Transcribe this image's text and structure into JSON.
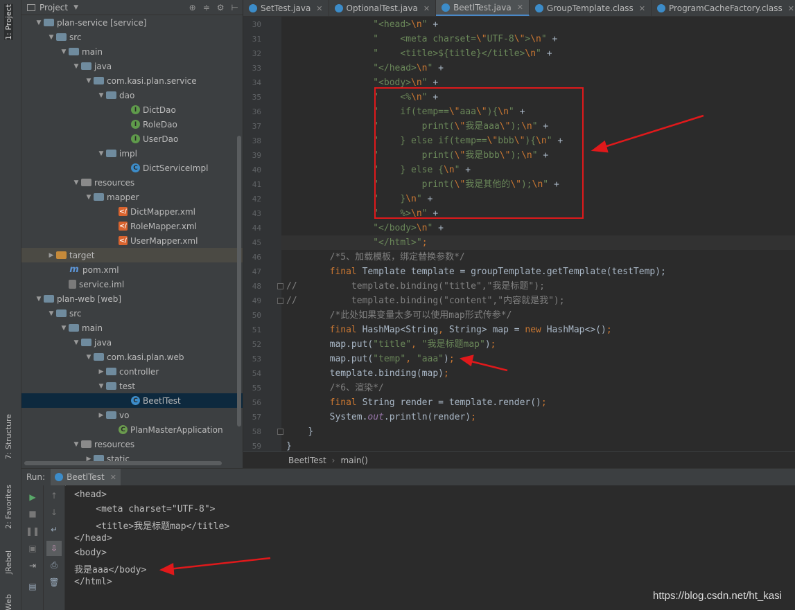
{
  "left_strip": {
    "project_tab": "1: Project",
    "structure_tab": "7: Structure",
    "favorites_tab": "2: Favorites",
    "jrebel_tab": "JRebel",
    "web_tab": "Web"
  },
  "project_panel": {
    "title": "Project",
    "tree": [
      {
        "label": "plan-service [service]",
        "indent": 0,
        "arrow": "▼",
        "icon": "folder",
        "hl": false
      },
      {
        "label": "src",
        "indent": 1,
        "arrow": "▼",
        "icon": "folder",
        "hl": false
      },
      {
        "label": "main",
        "indent": 2,
        "arrow": "▼",
        "icon": "folder",
        "hl": false
      },
      {
        "label": "java",
        "indent": 3,
        "arrow": "▼",
        "icon": "folder",
        "hl": false
      },
      {
        "label": "com.kasi.plan.service",
        "indent": 4,
        "arrow": "▼",
        "icon": "folder",
        "hl": false
      },
      {
        "label": "dao",
        "indent": 5,
        "arrow": "▼",
        "icon": "folder",
        "hl": false
      },
      {
        "label": "DictDao",
        "indent": 7,
        "arrow": "",
        "icon": "iface",
        "hl": false
      },
      {
        "label": "RoleDao",
        "indent": 7,
        "arrow": "",
        "icon": "iface",
        "hl": false
      },
      {
        "label": "UserDao",
        "indent": 7,
        "arrow": "",
        "icon": "iface",
        "hl": false
      },
      {
        "label": "impl",
        "indent": 5,
        "arrow": "▼",
        "icon": "folder",
        "hl": false
      },
      {
        "label": "DictServiceImpl",
        "indent": 7,
        "arrow": "",
        "icon": "cls",
        "hl": false
      },
      {
        "label": "resources",
        "indent": 3,
        "arrow": "▼",
        "icon": "res",
        "hl": false
      },
      {
        "label": "mapper",
        "indent": 4,
        "arrow": "▼",
        "icon": "folder",
        "hl": false
      },
      {
        "label": "DictMapper.xml",
        "indent": 6,
        "arrow": "",
        "icon": "xml",
        "hl": false
      },
      {
        "label": "RoleMapper.xml",
        "indent": 6,
        "arrow": "",
        "icon": "xml",
        "hl": false
      },
      {
        "label": "UserMapper.xml",
        "indent": 6,
        "arrow": "",
        "icon": "xml",
        "hl": false
      },
      {
        "label": "target",
        "indent": 1,
        "arrow": "▶",
        "icon": "orange",
        "hl": true
      },
      {
        "label": "pom.xml",
        "indent": 2,
        "arrow": "",
        "icon": "mvn",
        "hl": false
      },
      {
        "label": "service.iml",
        "indent": 2,
        "arrow": "",
        "icon": "iml",
        "hl": false
      },
      {
        "label": "plan-web [web]",
        "indent": 0,
        "arrow": "▼",
        "icon": "folder",
        "hl": false
      },
      {
        "label": "src",
        "indent": 1,
        "arrow": "▼",
        "icon": "folder",
        "hl": false
      },
      {
        "label": "main",
        "indent": 2,
        "arrow": "▼",
        "icon": "folder",
        "hl": false
      },
      {
        "label": "java",
        "indent": 3,
        "arrow": "▼",
        "icon": "folder",
        "hl": false
      },
      {
        "label": "com.kasi.plan.web",
        "indent": 4,
        "arrow": "▼",
        "icon": "folder",
        "hl": false
      },
      {
        "label": "controller",
        "indent": 5,
        "arrow": "▶",
        "icon": "folder",
        "hl": false
      },
      {
        "label": "test",
        "indent": 5,
        "arrow": "▼",
        "icon": "folder",
        "hl": false
      },
      {
        "label": "BeetlTest",
        "indent": 7,
        "arrow": "",
        "icon": "cls",
        "hl": false,
        "sel": true
      },
      {
        "label": "vo",
        "indent": 5,
        "arrow": "▶",
        "icon": "folder",
        "hl": false
      },
      {
        "label": "PlanMasterApplication",
        "indent": 6,
        "arrow": "",
        "icon": "spring",
        "hl": false
      },
      {
        "label": "resources",
        "indent": 3,
        "arrow": "▼",
        "icon": "res",
        "hl": false
      },
      {
        "label": "static",
        "indent": 4,
        "arrow": "▶",
        "icon": "folder",
        "hl": false
      }
    ]
  },
  "editor_tabs": [
    {
      "label": "SetTest.java",
      "active": false
    },
    {
      "label": "OptionalTest.java",
      "active": false
    },
    {
      "label": "BeetlTest.java",
      "active": true
    },
    {
      "label": "GroupTemplate.class",
      "active": false
    },
    {
      "label": "ProgramCacheFactory.class",
      "active": false
    }
  ],
  "editor": {
    "lines": [
      {
        "n": "30",
        "html": "                <span class='s'>\"&lt;head&gt;</span><span class='e'>\\n</span><span class='s'>\"</span> <span class='t'>+</span>"
      },
      {
        "n": "31",
        "html": "                <span class='s'>\"    &lt;meta charset=</span><span class='e'>\\\"</span><span class='s'>UTF-8</span><span class='e'>\\\"</span><span class='s'>&gt;</span><span class='e'>\\n</span><span class='s'>\"</span> <span class='t'>+</span>"
      },
      {
        "n": "32",
        "html": "                <span class='s'>\"    &lt;title&gt;${title}&lt;/title&gt;</span><span class='e'>\\n</span><span class='s'>\"</span> <span class='t'>+</span>"
      },
      {
        "n": "33",
        "html": "                <span class='s'>\"&lt;/head&gt;</span><span class='e'>\\n</span><span class='s'>\"</span> <span class='t'>+</span>"
      },
      {
        "n": "34",
        "html": "                <span class='s'>\"&lt;body&gt;</span><span class='e'>\\n</span><span class='s'>\"</span> <span class='t'>+</span>"
      },
      {
        "n": "35",
        "html": "                <span class='s'>\"    &lt;%</span><span class='e'>\\n</span><span class='s'>\"</span> <span class='t'>+</span>"
      },
      {
        "n": "36",
        "html": "                <span class='s'>\"    if(temp==</span><span class='e'>\\\"</span><span class='s'>aaa</span><span class='e'>\\\"</span><span class='s'>){</span><span class='e'>\\n</span><span class='s'>\"</span> <span class='t'>+</span>"
      },
      {
        "n": "37",
        "html": "                <span class='s'>\"        print(</span><span class='e'>\\\"</span><span class='s'>我是aaa</span><span class='e'>\\\"</span><span class='s'>);</span><span class='e'>\\n</span><span class='s'>\"</span> <span class='t'>+</span>"
      },
      {
        "n": "38",
        "html": "                <span class='s'>\"    } else if(temp==</span><span class='e'>\\\"</span><span class='s'>bbb</span><span class='e'>\\\"</span><span class='s'>){</span><span class='e'>\\n</span><span class='s'>\"</span> <span class='t'>+</span>"
      },
      {
        "n": "39",
        "html": "                <span class='s'>\"        print(</span><span class='e'>\\\"</span><span class='s'>我是bbb</span><span class='e'>\\\"</span><span class='s'>);</span><span class='e'>\\n</span><span class='s'>\"</span> <span class='t'>+</span>"
      },
      {
        "n": "40",
        "html": "                <span class='s'>\"    } else {</span><span class='e'>\\n</span><span class='s'>\"</span> <span class='t'>+</span>"
      },
      {
        "n": "41",
        "html": "                <span class='s'>\"        print(</span><span class='e'>\\\"</span><span class='s'>我是其他的</span><span class='e'>\\\"</span><span class='s'>);</span><span class='e'>\\n</span><span class='s'>\"</span> <span class='t'>+</span>"
      },
      {
        "n": "42",
        "html": "                <span class='s'>\"    }</span><span class='e'>\\n</span><span class='s'>\"</span> <span class='t'>+</span>"
      },
      {
        "n": "43",
        "html": "                <span class='s'>\"    %&gt;</span><span class='e'>\\n</span><span class='s'>\"</span> <span class='t'>+</span>"
      },
      {
        "n": "44",
        "html": "                <span class='s'>\"&lt;/body&gt;</span><span class='e'>\\n</span><span class='s'>\"</span> <span class='t'>+</span>"
      },
      {
        "n": "45",
        "html": "                <span class='s'>\"&lt;/html&gt;\"</span><span class='k'>;</span>"
      },
      {
        "n": "46",
        "html": "        <span class='c'>/*5、加载模板，绑定替换参数*/</span>"
      },
      {
        "n": "47",
        "html": "        <span class='k'>final</span> <span class='t'>Template template = groupTemplate.getTemplate(testTemp);</span>"
      },
      {
        "n": "48",
        "html": "<span class='c'>//</span>          <span class='c'>template.binding(\"title\",\"我是标题\");</span>"
      },
      {
        "n": "49",
        "html": "<span class='c'>//</span>          <span class='c'>template.binding(\"content\",\"内容就是我\");</span>"
      },
      {
        "n": "50",
        "html": "        <span class='c'>/*此处如果变量太多可以使用map形式传参*/</span>"
      },
      {
        "n": "51",
        "html": "        <span class='k'>final</span> <span class='t'>HashMap&lt;String</span><span class='k'>,</span> <span class='t'>String&gt; map = </span><span class='k'>new</span> <span class='t'>HashMap&lt;&gt;()</span><span class='k'>;</span>"
      },
      {
        "n": "52",
        "html": "        <span class='t'>map.put(</span><span class='s'>\"title\"</span><span class='k'>,</span> <span class='s'>\"我是标题map\"</span><span class='t'>)</span><span class='k'>;</span>"
      },
      {
        "n": "53",
        "html": "        <span class='t'>map.put(</span><span class='s'>\"temp\"</span><span class='k'>,</span> <span class='s'>\"aaa\"</span><span class='t'>)</span><span class='k'>;</span>"
      },
      {
        "n": "54",
        "html": "        <span class='t'>template.binding(map)</span><span class='k'>;</span>"
      },
      {
        "n": "55",
        "html": "        <span class='c'>/*6、渲染*/</span>"
      },
      {
        "n": "56",
        "html": "        <span class='k'>final</span> <span class='t'>String render = template.render()</span><span class='k'>;</span>"
      },
      {
        "n": "57",
        "html": "        <span class='t'>System.</span><span class='f'>out</span><span class='t'>.println(render)</span><span class='k'>;</span>"
      },
      {
        "n": "58",
        "html": "    <span class='t'>}</span>"
      },
      {
        "n": "59",
        "html": "<span class='t'>}</span>"
      }
    ]
  },
  "breadcrumb": {
    "class_name": "BeetlTest",
    "method": "main()"
  },
  "run_panel": {
    "label": "Run:",
    "tab_label": "BeetlTest",
    "console_lines": [
      "<head>",
      "    <meta charset=\"UTF-8\">",
      "    <title>我是标题map</title>",
      "</head>",
      "<body>",
      "我是aaa</body>",
      "</html>"
    ]
  },
  "watermark": "https://blog.csdn.net/ht_kasi",
  "colors": {
    "highlight_box": "#e0191b",
    "arrow": "#e0191b"
  }
}
